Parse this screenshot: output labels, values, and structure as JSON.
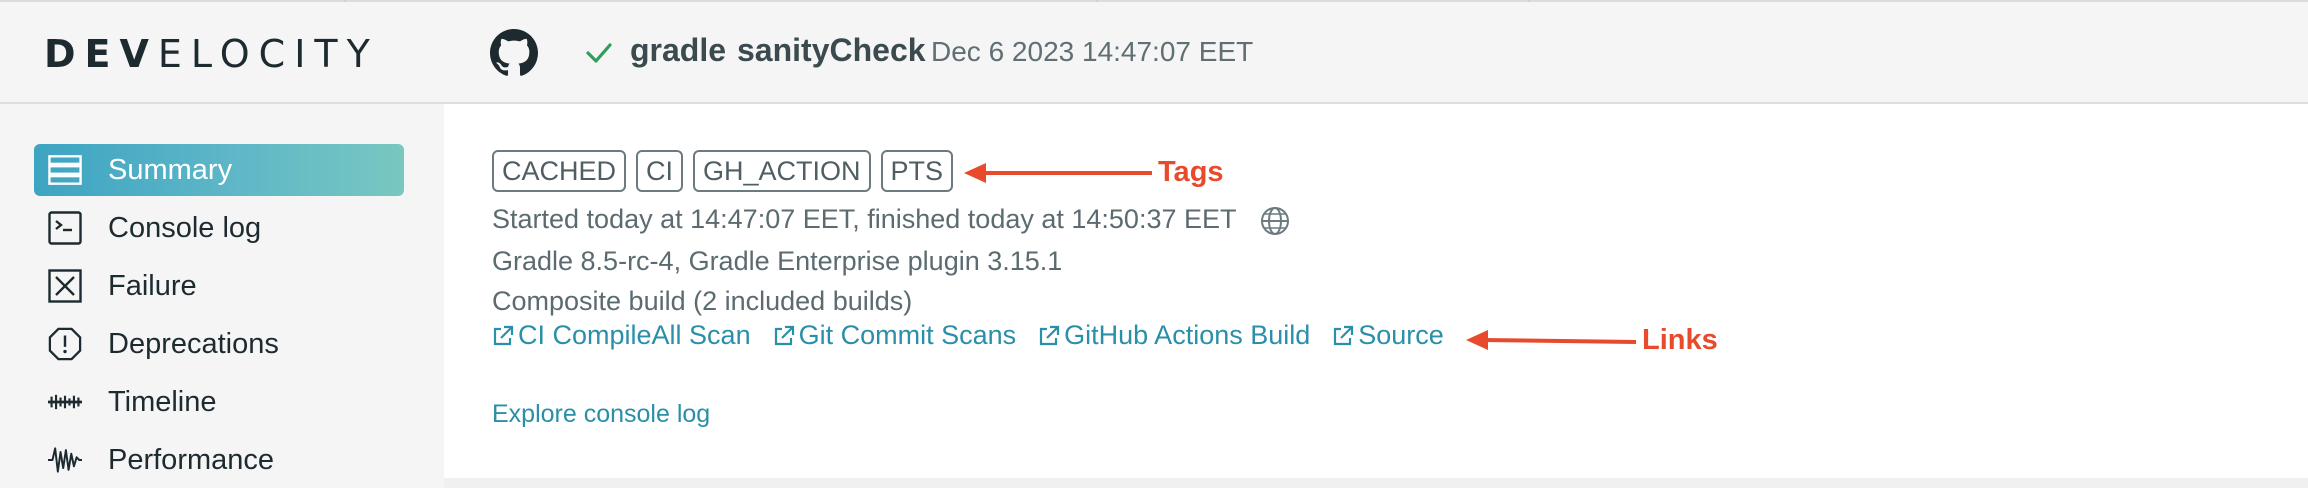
{
  "logo": {
    "bold": "DEV",
    "rest": "ELOCITY"
  },
  "header": {
    "status": "success",
    "project": "gradle",
    "task": "sanityCheck",
    "timestamp": "Dec 6 2023 14:47:07 EET"
  },
  "sidebar": {
    "items": [
      {
        "label": "Summary",
        "icon": "summary-icon",
        "active": true
      },
      {
        "label": "Console log",
        "icon": "console-icon"
      },
      {
        "label": "Failure",
        "icon": "failure-icon"
      },
      {
        "label": "Deprecations",
        "icon": "deprecations-icon"
      },
      {
        "label": "Timeline",
        "icon": "timeline-icon"
      },
      {
        "label": "Performance",
        "icon": "performance-icon"
      }
    ]
  },
  "summary": {
    "tags": [
      "CACHED",
      "CI",
      "GH_ACTION",
      "PTS"
    ],
    "timing": "Started today at 14:47:07 EET, finished today at 14:50:37 EET",
    "versions": "Gradle 8.5-rc-4,  Gradle Enterprise plugin 3.15.1",
    "composite": "Composite build (2 included builds)",
    "links": [
      "CI CompileAll Scan",
      "Git Commit Scans",
      "GitHub Actions Build",
      "Source"
    ],
    "explore": "Explore console log"
  },
  "annotations": {
    "tags_label": "Tags",
    "links_label": "Links"
  },
  "colors": {
    "accent": "#2a8fa8",
    "annotation": "#e84a2c",
    "success": "#2e9e5b"
  }
}
